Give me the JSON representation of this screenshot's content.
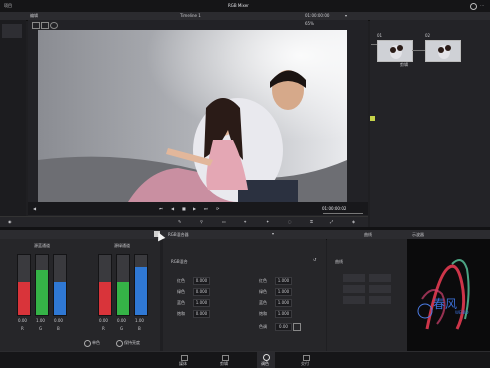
{
  "app": {
    "title": "RGB Mixer",
    "menu_left": "项目",
    "menu_sub": "编辑"
  },
  "viewer": {
    "timeline_label": "Timeline 1",
    "top_timecode": "01:00:00:00",
    "zoom": "65%",
    "timecode": "01:00:00:02"
  },
  "nodes": {
    "label": "01",
    "node1_label": "剪辑",
    "node2_label": "02"
  },
  "palette": {
    "tab_rgb_mixer": "RGB混合器",
    "tab_curves": "曲线",
    "tab_scopes": "示波器"
  },
  "mixer": {
    "group1_title": "源蓝通道",
    "group2_title": "源绿通道",
    "group1_values": [
      "0.00",
      "1.00",
      "0.00"
    ],
    "group1_letters": [
      "R",
      "G",
      "B"
    ],
    "group1_levels": [
      0.55,
      0.75,
      0.55
    ],
    "group2_values": [
      "0.00",
      "0.00",
      "1.00"
    ],
    "group2_letters": [
      "R",
      "G",
      "B"
    ],
    "group2_levels": [
      0.55,
      0.55,
      0.8
    ],
    "mono_label": "单色",
    "preserve_label": "保持亮度"
  },
  "rgbmix": {
    "title": "RGB混合",
    "col1": [
      {
        "label": "红色",
        "value": "0.000"
      },
      {
        "label": "绿色",
        "value": "0.000"
      },
      {
        "label": "蓝色",
        "value": "1.000"
      },
      {
        "label": "饱和",
        "value": "0.000"
      }
    ],
    "col2": [
      {
        "label": "红色",
        "value": "1.000"
      },
      {
        "label": "绿色",
        "value": "1.000"
      },
      {
        "label": "蓝色",
        "value": "1.000"
      },
      {
        "label": "饱和",
        "value": "1.000"
      },
      {
        "label": "色调",
        "value": "0.00"
      }
    ]
  },
  "curves": {
    "title": "曲线"
  },
  "bottom_nav": [
    "媒体",
    "剪辑",
    "调色",
    "交付"
  ],
  "watermark": {
    "text": "春风",
    "sub": "WEIBO"
  },
  "colors": {
    "accent": "#e84d3d",
    "active": "#c8c8cc"
  }
}
